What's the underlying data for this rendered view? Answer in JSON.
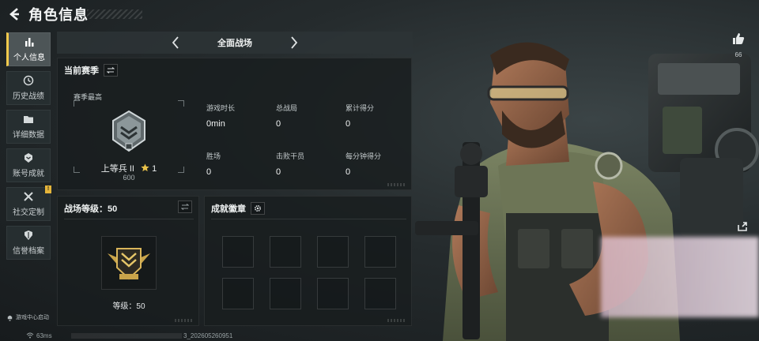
{
  "header": {
    "title": "角色信息"
  },
  "sidebar": {
    "items": [
      {
        "label": "个人信息",
        "icon": "bar-chart-icon",
        "active": true
      },
      {
        "label": "历史战绩",
        "icon": "history-icon"
      },
      {
        "label": "详细数据",
        "icon": "folder-icon"
      },
      {
        "label": "账号成就",
        "icon": "medal-icon"
      },
      {
        "label": "社交定制",
        "icon": "tools-icon",
        "badge": "!"
      },
      {
        "label": "信誉档案",
        "icon": "shield-icon"
      }
    ],
    "help_label": "游戏中心启动"
  },
  "mode_selector": {
    "label": "全面战场"
  },
  "season": {
    "title": "当前赛季",
    "peak_label": "赛季最高",
    "rank_name": "上等兵 II",
    "stars": "1",
    "points": "600",
    "stats": [
      {
        "label": "游戏时长",
        "value": "0min"
      },
      {
        "label": "总战局",
        "value": "0"
      },
      {
        "label": "累计得分",
        "value": "0"
      },
      {
        "label": "胜场",
        "value": "0"
      },
      {
        "label": "击败干员",
        "value": "0"
      },
      {
        "label": "每分钟得分",
        "value": "0"
      }
    ]
  },
  "battlefield_level": {
    "title": "战场等级：50",
    "level_label": "等级：50"
  },
  "achievements": {
    "title": "成就徽章"
  },
  "social": {
    "like_count": "66"
  },
  "status_bar": {
    "ping": "63ms",
    "uid_suffix": "3_202605260951"
  },
  "colors": {
    "accent": "#f2c94c",
    "panel": "#181d1f",
    "text": "#e6e9ea"
  }
}
